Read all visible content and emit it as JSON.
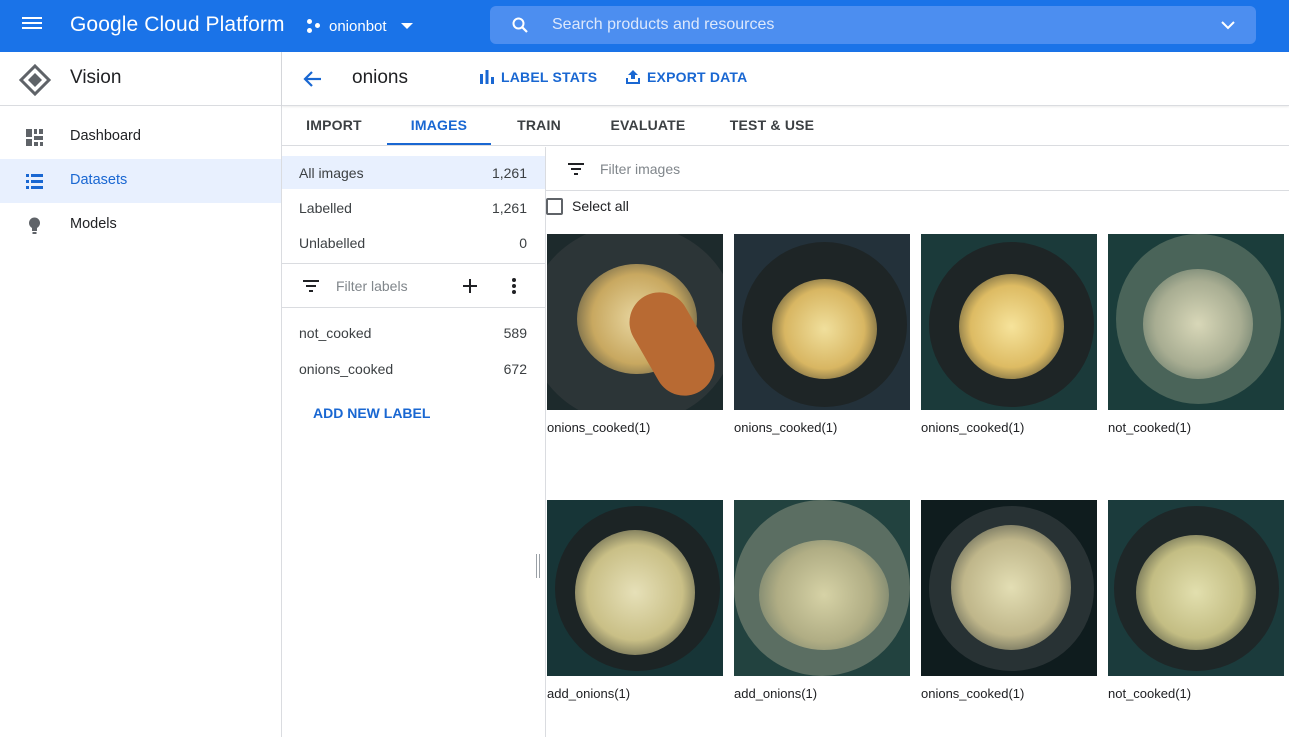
{
  "header": {
    "brand": "Google Cloud Platform",
    "project": "onionbot",
    "search_placeholder": "Search products and resources"
  },
  "sidebar": {
    "title": "Vision",
    "items": [
      {
        "label": "Dashboard",
        "icon": "dashboard-icon"
      },
      {
        "label": "Datasets",
        "icon": "list-icon",
        "active": true
      },
      {
        "label": "Models",
        "icon": "lightbulb-icon"
      }
    ]
  },
  "dataset": {
    "name": "onions",
    "label_stats": "LABEL STATS",
    "export_data": "EXPORT DATA"
  },
  "tabs": [
    {
      "label": "IMPORT"
    },
    {
      "label": "IMAGES",
      "active": true
    },
    {
      "label": "TRAIN"
    },
    {
      "label": "EVALUATE"
    },
    {
      "label": "TEST & USE"
    }
  ],
  "image_filters": [
    {
      "name": "All images",
      "count": "1,261",
      "active": true
    },
    {
      "name": "Labelled",
      "count": "1,261"
    },
    {
      "name": "Unlabelled",
      "count": "0"
    }
  ],
  "labels": {
    "filter_placeholder": "Filter labels",
    "items": [
      {
        "name": "not_cooked",
        "count": "589"
      },
      {
        "name": "onions_cooked",
        "count": "672"
      }
    ],
    "add_new": "ADD NEW LABEL"
  },
  "images": {
    "filter_placeholder": "Filter images",
    "select_all": "Select all",
    "grid": [
      {
        "caption": "onions_cooked(1)"
      },
      {
        "caption": "onions_cooked(1)"
      },
      {
        "caption": "onions_cooked(1)"
      },
      {
        "caption": "not_cooked(1)"
      },
      {
        "caption": "add_onions(1)"
      },
      {
        "caption": "add_onions(1)"
      },
      {
        "caption": "onions_cooked(1)"
      },
      {
        "caption": "not_cooked(1)"
      }
    ]
  },
  "colors": {
    "brand_blue": "#1a73e8",
    "link_blue": "#1967d2",
    "active_bg": "#e8f0fe"
  }
}
